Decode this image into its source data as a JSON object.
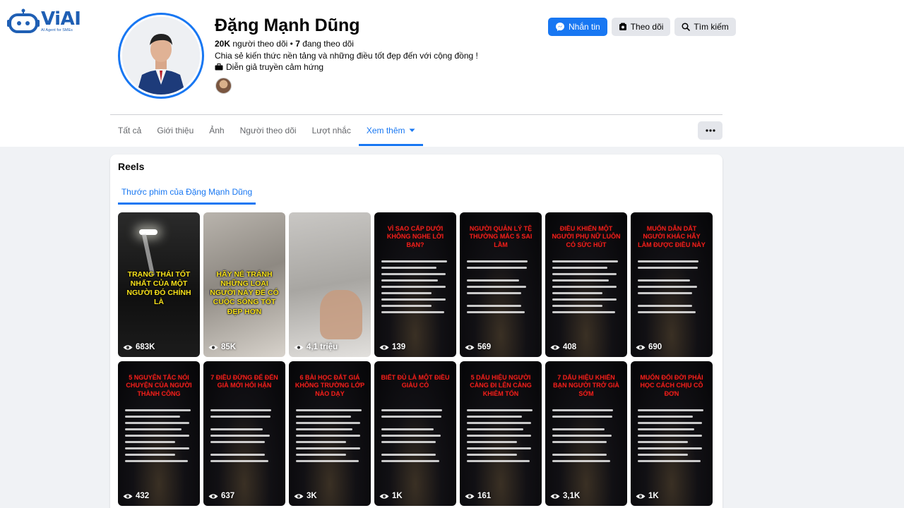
{
  "logo": {
    "name": "ViAI",
    "tagline": "AI Agent for SMEs"
  },
  "profile": {
    "name": "Đặng Mạnh Dũng",
    "followers": "20K",
    "followers_label": "người theo dõi",
    "following": "7",
    "following_label": "đang theo dõi",
    "bio": "Chia sẻ kiến thức nền tảng và những điều tốt đẹp đến với cộng đồng !",
    "category": "Diễn giả truyền cảm hứng"
  },
  "actions": {
    "message": "Nhắn tin",
    "follow": "Theo dõi",
    "search": "Tìm kiếm"
  },
  "tabs": [
    {
      "label": "Tất cả"
    },
    {
      "label": "Giới thiệu"
    },
    {
      "label": "Ảnh"
    },
    {
      "label": "Người theo dõi"
    },
    {
      "label": "Lượt nhắc"
    },
    {
      "label": "Xem thêm"
    }
  ],
  "reels": {
    "title": "Reels",
    "subtab": "Thước phim của Đặng Mạnh Dũng",
    "items": [
      {
        "style": "photo1",
        "overlay": "TRẠNG THÁI TỐT NHẤT CỦA MỘT NGƯỜI ĐÓ CHÍNH LÀ",
        "views": "683K"
      },
      {
        "style": "photo2",
        "overlay": "HÃY NÉ TRÁNH NHỮNG LOẠI NGƯỜI NÀY ĐỂ CÓ CUỘC SỐNG TỐT ĐẸP HƠN",
        "views": "85K"
      },
      {
        "style": "photo3",
        "overlay": "",
        "views": "4,1 triệu"
      },
      {
        "style": "dark",
        "title": "VÌ SAO CẤP DƯỚI KHÔNG NGHE LỜI BẠN?",
        "views": "139"
      },
      {
        "style": "dark",
        "title": "NGƯỜI QUẢN LÝ TỆ THƯỜNG MẮC 5 SAI LẦM",
        "views": "569"
      },
      {
        "style": "dark",
        "title": "ĐIỀU KHIẾN MỘT NGƯỜI PHỤ NỮ LUÔN CÓ SỨC HÚT",
        "views": "408"
      },
      {
        "style": "dark",
        "title": "MUỐN DẪN DẮT NGƯỜI KHÁC HÃY LÀM ĐƯỢC ĐIỀU NÀY",
        "views": "690"
      },
      {
        "style": "dark",
        "title": "5 NGUYÊN TẮC NÓI CHUYỆN CỦA NGƯỜI THÀNH CÔNG",
        "views": "432"
      },
      {
        "style": "dark",
        "title": "7 ĐIỀU ĐỪNG ĐỂ ĐẾN GIÀ MỚI HỐI HẬN",
        "views": "637"
      },
      {
        "style": "dark",
        "title": "6 BÀI HỌC ĐẮT GIÁ KHÔNG TRƯỜNG LỚP NÀO DẠY",
        "views": "3K"
      },
      {
        "style": "dark",
        "title": "BIẾT ĐỦ LÀ MỘT ĐIỀU GIÀU CÓ",
        "views": "1K"
      },
      {
        "style": "dark",
        "title": "5 DẤU HIỆU NGƯỜI CÀNG ĐI LÊN CÀNG KHIÊM TỐN",
        "views": "161"
      },
      {
        "style": "dark",
        "title": "7 DẤU HIỆU KHIẾN BẠN NGƯỜI TRỞ GIÀ SỚM",
        "views": "3,1K"
      },
      {
        "style": "dark",
        "title": "MUỐN ĐỔI ĐỜI PHẢI HỌC CÁCH CHỊU CÔ ĐƠN",
        "views": "1K"
      }
    ]
  },
  "colors": {
    "accent": "#1877f2",
    "reel_title": "#e7211d",
    "overlay_text": "#f7e11b"
  }
}
